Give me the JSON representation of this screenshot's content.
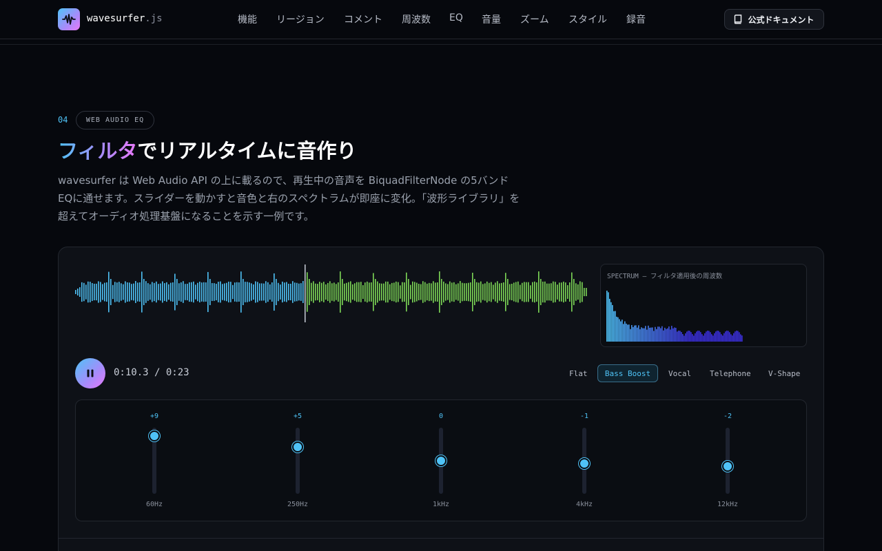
{
  "header": {
    "brand_name": "wavesurfer",
    "brand_ext": ".js",
    "nav": [
      "機能",
      "リージョン",
      "コメント",
      "周波数",
      "EQ",
      "音量",
      "ズーム",
      "スタイル",
      "録音"
    ],
    "docs_label": "公式ドキュメント",
    "icons": {
      "logo": "waveform-icon",
      "docs": "book-icon"
    }
  },
  "section": {
    "number": "04",
    "tag": "WEB AUDIO EQ",
    "title_highlight": "フィルタ",
    "title_rest": "でリアルタイムに音作り",
    "description": "wavesurfer は Web Audio API の上に載るので、再生中の音声を BiquadFilterNode の5バンドEQに通せます。スライダーを動かすと音色と右のスペクトラムが即座に変化。「波形ライブラリ」を超えてオーディオ処理基盤になることを示す一例です。"
  },
  "player": {
    "spectrum_label": "SPECTRUM — フィルタ適用後の周波数",
    "time_display": "0:10.3 / 0:23",
    "current_seconds": 10.3,
    "duration_seconds": 23,
    "play_state": "playing",
    "play_icon": "pause-icon",
    "colors": {
      "played": "#4fc3f7",
      "unplayed": "#7ed957",
      "cursor": "#c9ced8",
      "spectrum_low": "#4fc3f7",
      "spectrum_high": "#3b2fd9",
      "accent": "#4fc3f7"
    },
    "presets": [
      {
        "label": "Flat",
        "active": false
      },
      {
        "label": "Bass Boost",
        "active": true
      },
      {
        "label": "Vocal",
        "active": false
      },
      {
        "label": "Telephone",
        "active": false
      },
      {
        "label": "V-Shape",
        "active": false
      }
    ],
    "eq": {
      "range_db": [
        -12,
        12
      ],
      "bands": [
        {
          "freq": "60Hz",
          "gain_label": "+9",
          "gain": 9
        },
        {
          "freq": "250Hz",
          "gain_label": "+5",
          "gain": 5
        },
        {
          "freq": "1kHz",
          "gain_label": "0",
          "gain": 0
        },
        {
          "freq": "4kHz",
          "gain_label": "-1",
          "gain": -1
        },
        {
          "freq": "12kHz",
          "gain_label": "-2",
          "gain": -2
        }
      ]
    }
  }
}
